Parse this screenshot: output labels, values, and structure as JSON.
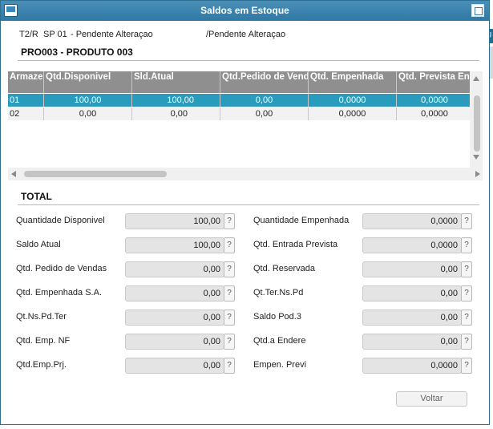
{
  "window": {
    "title": "Saldos em Estoque"
  },
  "background": {
    "tab_text": "U"
  },
  "header": {
    "branch": "T2/R",
    "location": "SP 01",
    "status_left": "- Pendente Alteraçao",
    "status_right": "/Pendente Alteraçao",
    "product": "PRO003 - PRODUTO 003"
  },
  "grid": {
    "columns": [
      "Armaze",
      "Qtd.Disponivel",
      "Sld.Atual",
      "Qtd.Pedido de Vendas",
      "Qtd. Empenhada",
      "Qtd. Prevista Ent"
    ],
    "rows": [
      [
        "01",
        "100,00",
        "100,00",
        "0,00",
        "0,0000",
        "0,0000"
      ],
      [
        "02",
        "0,00",
        "0,00",
        "0,00",
        "0,0000",
        "0,0000"
      ]
    ],
    "selected_row": 0
  },
  "total": {
    "label": "TOTAL",
    "left_fields": [
      {
        "label": "Quantidade Disponivel",
        "value": "100,00"
      },
      {
        "label": "Saldo Atual",
        "value": "100,00"
      },
      {
        "label": "Qtd. Pedido de Vendas",
        "value": "0,00"
      },
      {
        "label": "Qtd. Empenhada S.A.",
        "value": "0,00"
      },
      {
        "label": "Qt.Ns.Pd.Ter",
        "value": "0,00"
      },
      {
        "label": "Qtd. Emp. NF",
        "value": "0,00"
      },
      {
        "label": "Qtd.Emp.Prj.",
        "value": "0,00"
      }
    ],
    "right_fields": [
      {
        "label": "Quantidade Empenhada",
        "value": "0,0000"
      },
      {
        "label": "Qtd. Entrada Prevista",
        "value": "0,0000"
      },
      {
        "label": "Qtd. Reservada",
        "value": "0,00"
      },
      {
        "label": "Qt.Ter.Ns.Pd",
        "value": "0,00"
      },
      {
        "label": "Saldo Pod.3",
        "value": "0,00"
      },
      {
        "label": "Qtd.a Endere",
        "value": "0,00"
      },
      {
        "label": "Empen. Previ",
        "value": "0,0000"
      }
    ],
    "help_label": "?"
  },
  "buttons": {
    "voltar": "Voltar"
  },
  "colors": {
    "titlebar": "#2f79a5",
    "selected_row": "#2a9bbd",
    "header_bg": "#8f8f8f"
  }
}
